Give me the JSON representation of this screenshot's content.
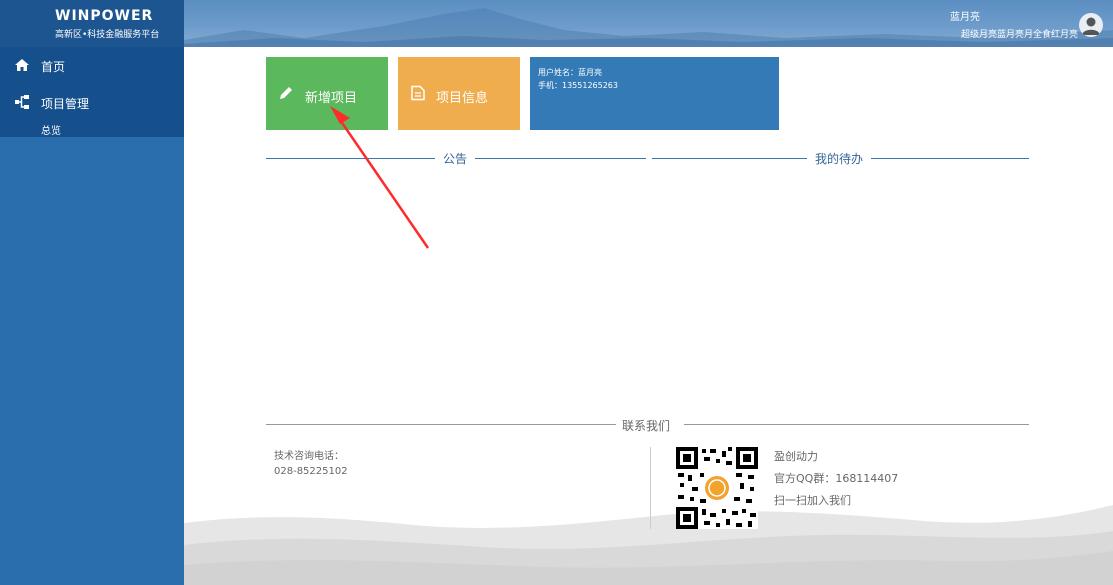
{
  "brand": {
    "logo": "WINPOWER",
    "subtitle": "高新区•科技金融服务平台"
  },
  "sidebar": {
    "items": [
      {
        "label": "首页",
        "icon": "home-icon"
      },
      {
        "label": "项目管理",
        "icon": "sitemap-icon"
      }
    ],
    "sub_items": [
      {
        "label": "总览"
      }
    ]
  },
  "header": {
    "user_name": "蓝月亮",
    "user_role": "超级月亮蓝月亮月全食红月亮",
    "avatar_icon": "user-avatar-icon"
  },
  "tiles": {
    "new_project": {
      "label": "新增项目",
      "icon": "pencil-icon",
      "color": "#5cb85c"
    },
    "project_info": {
      "label": "项目信息",
      "icon": "document-icon",
      "color": "#f0ad4e"
    },
    "user_info": {
      "name_line": "用户姓名：蓝月亮",
      "phone_line": "手机：13551265263",
      "color": "#337ab7"
    }
  },
  "sections": {
    "notice_title": "公告",
    "todo_title": "我的待办"
  },
  "footer": {
    "contact_title": "联系我们",
    "tech_label": "技术咨询电话：",
    "tech_phone": "028-85225102",
    "company": "盈创动力",
    "qq_group": "官方QQ群：168114407",
    "scan_text": "扫一扫加入我们",
    "qr_icon": "qr-code-icon"
  },
  "annotation": {
    "arrow_color": "#ff2a2a",
    "arrow_icon": "red-arrow-annotation"
  }
}
